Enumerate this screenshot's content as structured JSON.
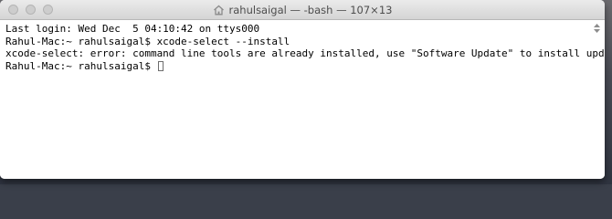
{
  "window": {
    "title": "rahulsaigal — -bash — 107×13",
    "icons": {
      "title": "home-folder-icon",
      "scroll": "scroll-indicator-icon"
    }
  },
  "terminal": {
    "lines": [
      "Last login: Wed Dec  5 04:10:42 on ttys000",
      "Rahul-Mac:~ rahulsaigal$ xcode-select --install",
      "xcode-select: error: command line tools are already installed, use \"Software Update\" to install updates"
    ],
    "prompt": "Rahul-Mac:~ rahulsaigal$ "
  },
  "colors": {
    "background": "#ffffff",
    "text": "#000000",
    "titlebar": "#e0e0e0"
  }
}
